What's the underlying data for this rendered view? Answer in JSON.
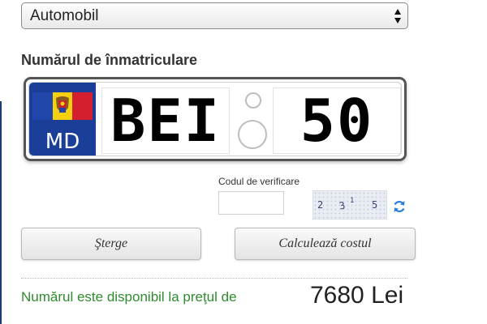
{
  "vehicle_select": {
    "selected": "Automobil",
    "arrows_icon": "updown-arrows-icon"
  },
  "plate_section": {
    "title": "Numărul de înmatriculare",
    "country_code": "MD",
    "flag_colors": [
      "#1f46a8",
      "#f5d010",
      "#d4202e"
    ],
    "flag_emblem_icon": "moldova-coat-of-arms-icon",
    "series": "BEI",
    "number": "50"
  },
  "captcha": {
    "label": "Codul de verificare",
    "input_value": "",
    "digits": [
      "2",
      "3",
      "1",
      "5"
    ],
    "refresh_icon": "refresh-icon"
  },
  "actions": {
    "clear_label": "Şterge",
    "calculate_label": "Calculează costul"
  },
  "result": {
    "text": "Numărul este disponibil la preţul de",
    "price": "7680 Lei",
    "text_color": "#2e8b2e"
  }
}
